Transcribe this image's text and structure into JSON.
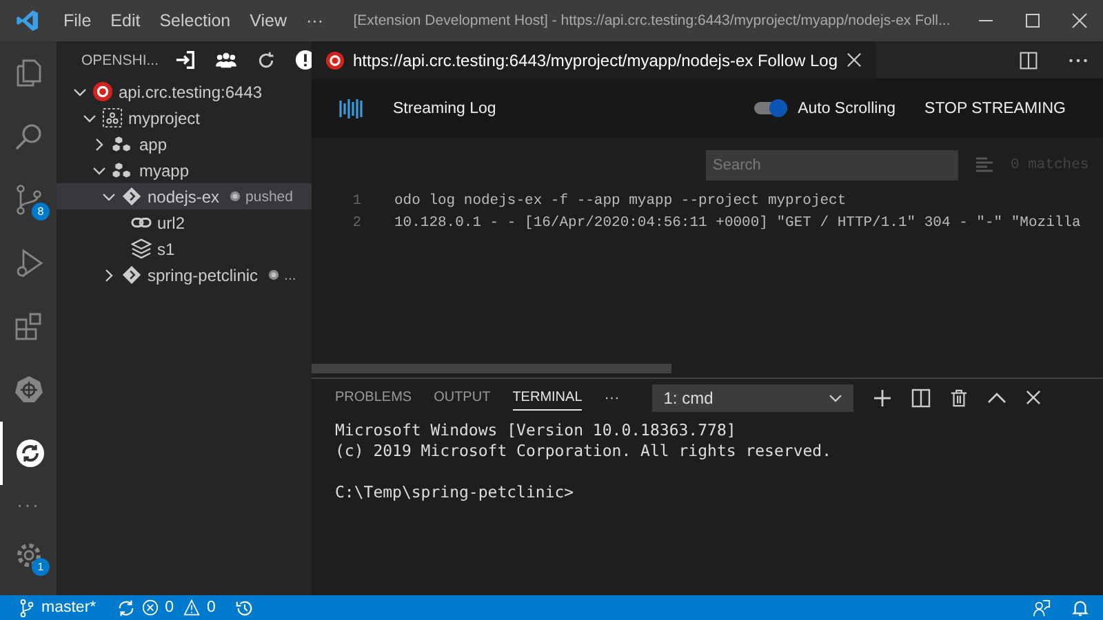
{
  "title_bar": {
    "menu": [
      "File",
      "Edit",
      "Selection",
      "View"
    ],
    "more": "···",
    "title": "[Extension Development Host] - https://api.crc.testing:6443/myproject/myapp/nodejs-ex Foll..."
  },
  "activity_bar": {
    "items": [
      {
        "kind": "explorer",
        "selected": false
      },
      {
        "kind": "search",
        "selected": false
      },
      {
        "kind": "source-control",
        "selected": false,
        "badge": "8"
      },
      {
        "kind": "debug",
        "selected": false
      },
      {
        "kind": "extensions",
        "selected": false
      },
      {
        "kind": "kubernetes",
        "selected": false
      },
      {
        "kind": "openshift",
        "selected": true
      }
    ],
    "more": "···",
    "settings_badge": "1"
  },
  "sidebar": {
    "title": "OPENSHI...",
    "tree": [
      {
        "kind": "cluster",
        "label": "api.crc.testing:6443",
        "expanded": true,
        "selected": false,
        "children": [
          {
            "kind": "project",
            "label": "myproject",
            "expanded": true,
            "selected": false,
            "children": [
              {
                "kind": "application",
                "label": "app",
                "expanded": false,
                "selected": false
              },
              {
                "kind": "application",
                "label": "myapp",
                "expanded": true,
                "selected": false,
                "children": [
                  {
                    "kind": "component",
                    "label": "nodejs-ex",
                    "status": "pushed",
                    "expanded": true,
                    "selected": true,
                    "children": [
                      {
                        "kind": "url",
                        "label": "url2",
                        "selected": false
                      },
                      {
                        "kind": "storage",
                        "label": "s1",
                        "selected": false
                      }
                    ]
                  },
                  {
                    "kind": "component",
                    "label": "spring-petclinic",
                    "status": "...",
                    "expanded": false,
                    "selected": false
                  }
                ]
              }
            ]
          }
        ]
      }
    ]
  },
  "editor_tab": {
    "title": "https://api.crc.testing:6443/myproject/myapp/nodejs-ex Follow Log",
    "selected": true
  },
  "webview": {
    "header": "Streaming Log",
    "auto_scroll": {
      "label": "Auto Scrolling",
      "on": true
    },
    "stop_button": "STOP STREAMING",
    "search": {
      "placeholder": "Search"
    },
    "matches": "0 matches",
    "lines": [
      {
        "number": "1",
        "text": "odo log nodejs-ex -f --app myapp --project myproject"
      },
      {
        "number": "2",
        "text": "10.128.0.1 - - [16/Apr/2020:04:56:11 +0000] \"GET / HTTP/1.1\" 304 - \"-\" \"Mozilla"
      }
    ]
  },
  "panel": {
    "tabs": [
      {
        "label": "PROBLEMS",
        "selected": false
      },
      {
        "label": "OUTPUT",
        "selected": false
      },
      {
        "label": "TERMINAL",
        "selected": true
      }
    ],
    "more": "···",
    "terminal_select": "1: cmd",
    "terminal_blocks": [
      [
        "Microsoft Windows [Version 10.0.18363.778]",
        "(c) 2019 Microsoft Corporation. All rights reserved."
      ],
      [
        "C:\\Temp\\spring-petclinic>"
      ]
    ]
  },
  "status_bar": {
    "branch": "master*",
    "errors": "0",
    "warnings": "0"
  }
}
